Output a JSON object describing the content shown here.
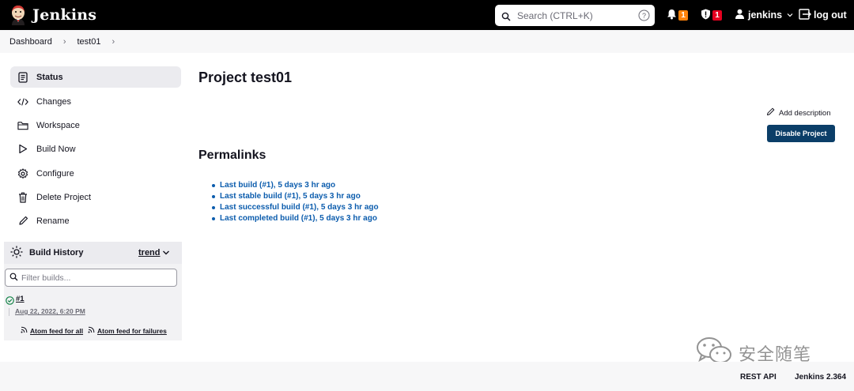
{
  "header": {
    "app_name": "Jenkins",
    "search_placeholder": "Search (CTRL+K)",
    "notifications_count": "1",
    "security_count": "1",
    "user_name": "jenkins",
    "logout_label": "log out",
    "colors": {
      "bar": "#000000",
      "notification_badge": "#fe820a",
      "security_badge": "#e6001f"
    }
  },
  "breadcrumb": [
    "Dashboard",
    "test01"
  ],
  "sidebar": {
    "items": [
      {
        "label": "Status",
        "icon": "status-icon",
        "active": true
      },
      {
        "label": "Changes",
        "icon": "code-icon"
      },
      {
        "label": "Workspace",
        "icon": "folder-icon"
      },
      {
        "label": "Build Now",
        "icon": "play-icon"
      },
      {
        "label": "Configure",
        "icon": "gear-icon"
      },
      {
        "label": "Delete Project",
        "icon": "trash-icon"
      },
      {
        "label": "Rename",
        "icon": "pencil-icon"
      }
    ]
  },
  "build_history": {
    "title": "Build History",
    "trend_label": "trend",
    "filter_placeholder": "Filter builds...",
    "builds": [
      {
        "number": "#1",
        "date": "Aug 22, 2022, 6:20 PM",
        "status": "success"
      }
    ],
    "feed_all": "Atom feed for all",
    "feed_failures": "Atom feed for failures"
  },
  "main": {
    "title": "Project test01",
    "add_description": "Add description",
    "disable_button": "Disable Project",
    "permalinks_title": "Permalinks",
    "permalinks": [
      "Last build (#1), 5 days 3 hr ago",
      "Last stable build (#1), 5 days 3 hr ago",
      "Last successful build (#1), 5 days 3 hr ago",
      "Last completed build (#1), 5 days 3 hr ago"
    ]
  },
  "footer": {
    "rest_api": "REST API",
    "version": "Jenkins 2.364"
  },
  "watermark": {
    "text": "安全随笔"
  }
}
